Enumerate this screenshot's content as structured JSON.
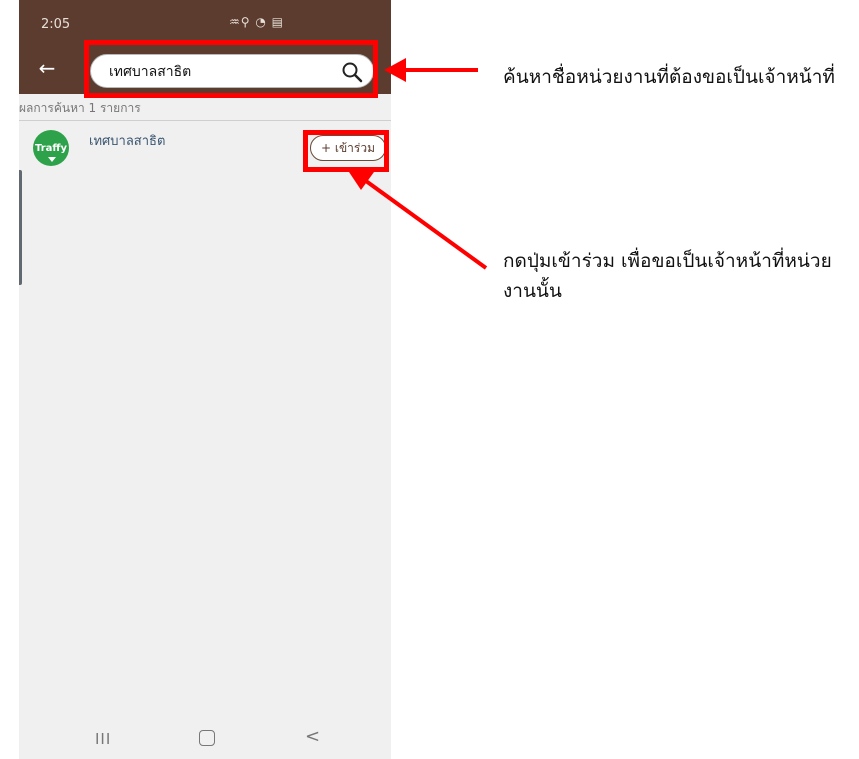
{
  "status_bar": {
    "time": "2:05",
    "icons": "♒⚲ ◔ ▤"
  },
  "app_bar": {
    "back_label": "←"
  },
  "search": {
    "value": "เทศบาลสาธิต"
  },
  "results": {
    "count_text": "ผลการค้นหา 1 รายการ",
    "items": [
      {
        "avatar_text": "Traffy",
        "name": "เทศบาลสาธิต",
        "join_label": "+ เข้าร่วม"
      }
    ]
  },
  "nav_bar": {
    "recent": "III",
    "back": "<"
  },
  "annotations": {
    "search_note": "ค้นหาชื่อหน่วยงานที่ต้องขอเป็นเจ้าหน้าที่",
    "join_note": "กดปุ่มเข้าร่วม เพื่อขอเป็นเจ้าหน้าที่หน่วยงานนั้น"
  },
  "colors": {
    "app_bar": "#5b3c2e",
    "callout": "#ff0000",
    "traffy_green": "#2ea24a"
  }
}
